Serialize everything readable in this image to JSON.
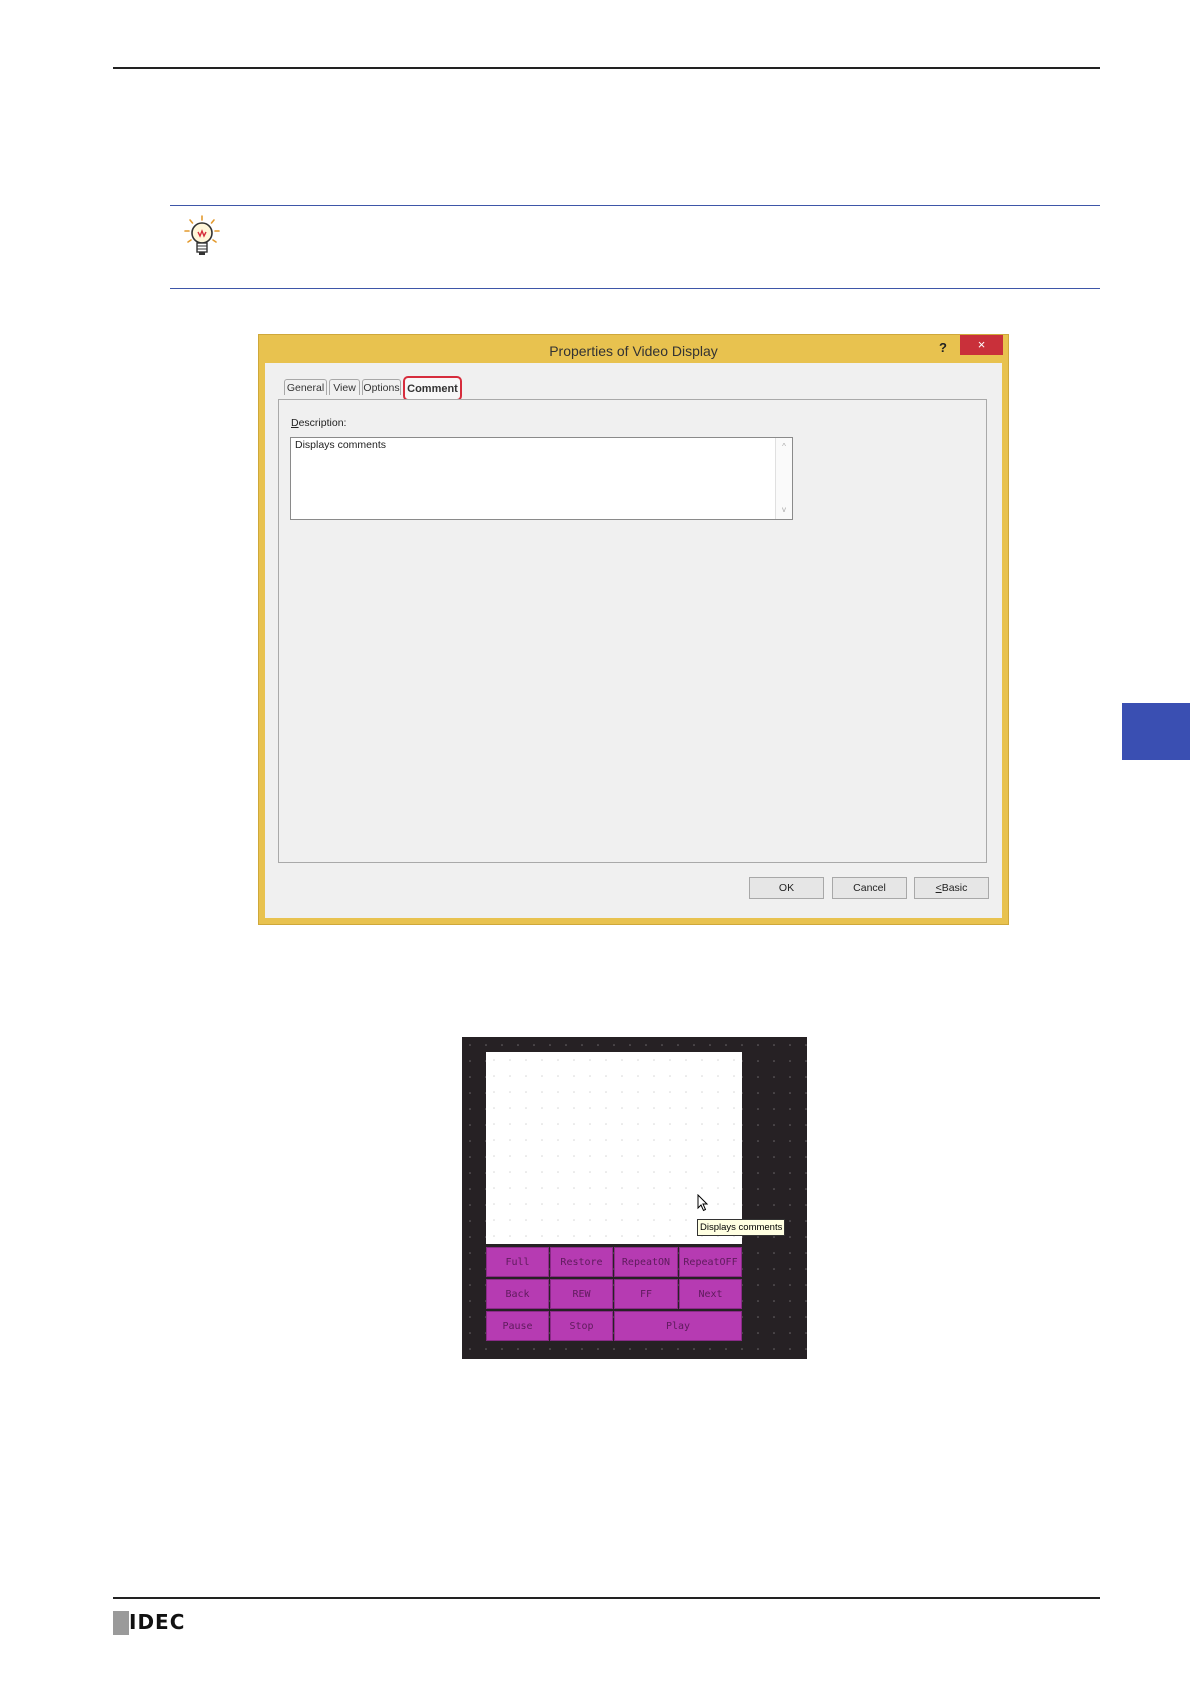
{
  "dialog": {
    "title": "Properties of Video Display",
    "help_label": "?",
    "close_label": "×",
    "tabs": [
      {
        "label": "General"
      },
      {
        "label": "View"
      },
      {
        "label": "Options"
      },
      {
        "label": "Comment"
      }
    ],
    "description_label_prefix": "D",
    "description_label_rest": "escription:",
    "description_value": "Displays comments",
    "scroll_up_glyph": "^",
    "scroll_down_glyph": "v",
    "ok_label": "OK",
    "cancel_label": "Cancel",
    "basic_label_prefix": "<",
    "basic_label_rest": "Basic"
  },
  "preview": {
    "controls": [
      {
        "label": "Full"
      },
      {
        "label": "Restore"
      },
      {
        "label": "RepeatON"
      },
      {
        "label": "RepeatOFF"
      },
      {
        "label": "Back"
      },
      {
        "label": "REW"
      },
      {
        "label": "FF"
      },
      {
        "label": "Next"
      },
      {
        "label": "Pause"
      },
      {
        "label": "Stop"
      },
      {
        "label": "Play"
      }
    ],
    "tooltip": "Displays comments"
  },
  "footer": {
    "logo_text": "IDEC"
  },
  "colors": {
    "accent_blue": "#3a4fb2",
    "dialog_frame": "#e8c24f",
    "highlight_red": "#d62c3c",
    "control_magenta": "#b63bb2"
  }
}
